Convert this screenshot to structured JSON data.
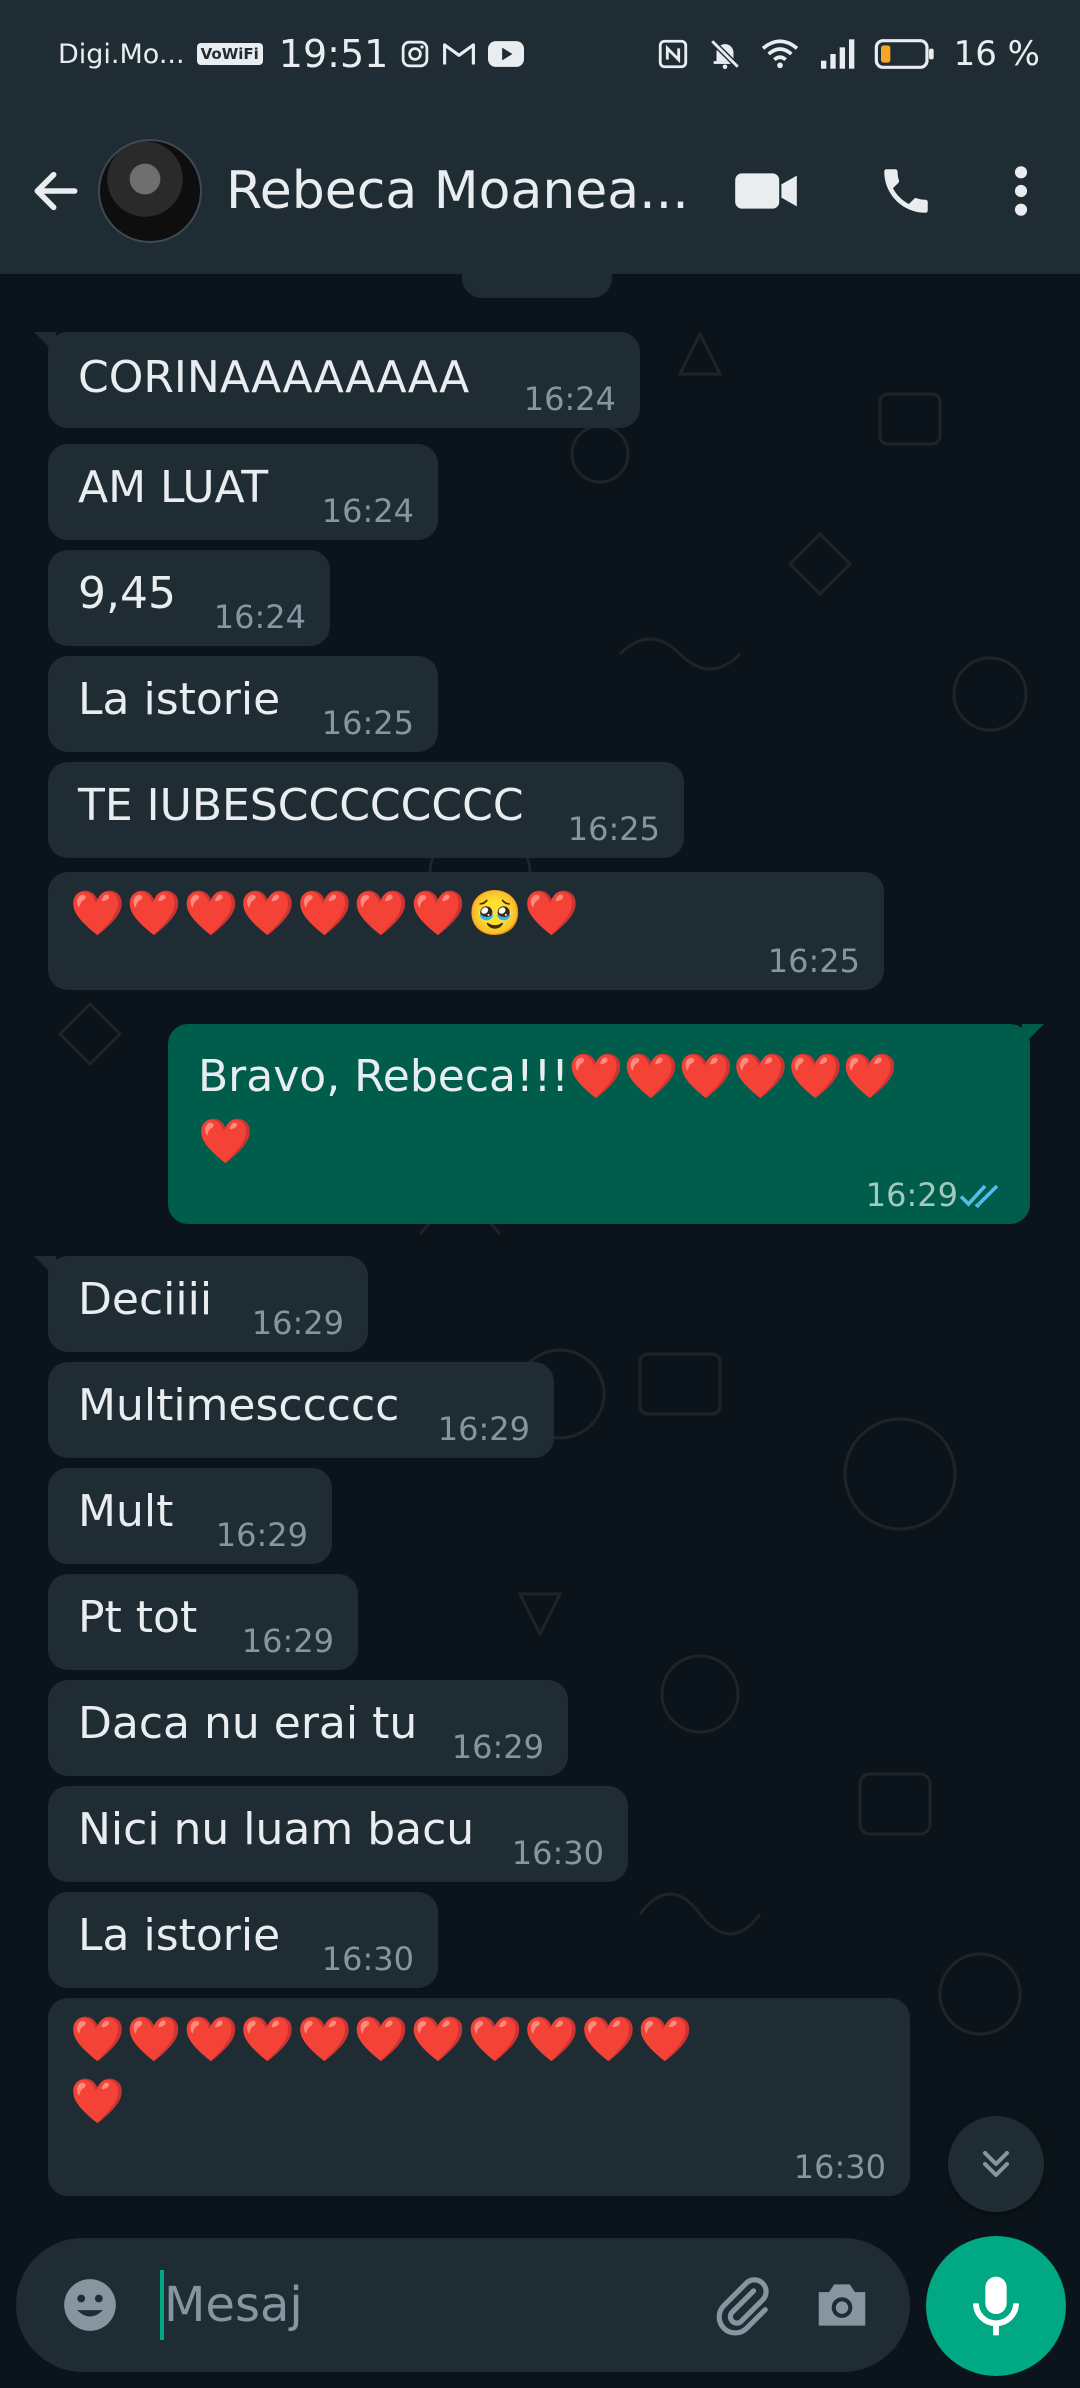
{
  "status_bar": {
    "carrier": "Digi.Mo...",
    "vowifi": "VoWiFi",
    "time": "19:51",
    "battery": "16 %"
  },
  "header": {
    "contact_name": "Rebeca Moanea..."
  },
  "messages": [
    {
      "text": "CORINAAAAAAAA",
      "time": "16:24"
    },
    {
      "text": "AM LUAT",
      "time": "16:24"
    },
    {
      "text": "9,45",
      "time": "16:24"
    },
    {
      "text": "La istorie",
      "time": "16:25"
    },
    {
      "text": "TE IUBESCCCCCCCC",
      "time": "16:25"
    },
    {
      "text": "❤️❤️❤️❤️❤️❤️❤️🥹❤️",
      "time": "16:25"
    },
    {
      "line1": "Bravo, Rebeca!!!❤️❤️❤️❤️❤️❤️",
      "line2": "❤️",
      "time": "16:29"
    },
    {
      "text": "Deciiii",
      "time": "16:29"
    },
    {
      "text": "Multimesccccc",
      "time": "16:29"
    },
    {
      "text": "Mult",
      "time": "16:29"
    },
    {
      "text": "Pt tot",
      "time": "16:29"
    },
    {
      "text": "Daca nu erai tu",
      "time": "16:29"
    },
    {
      "text": "Nici nu luam bacu",
      "time": "16:30"
    },
    {
      "text": "La istorie",
      "time": "16:30"
    },
    {
      "line1": "❤️❤️❤️❤️❤️❤️❤️❤️❤️❤️❤️",
      "line2": "❤️",
      "time": "16:30"
    }
  ],
  "composer": {
    "placeholder": "Mesaj"
  },
  "colors": {
    "background": "#0b141a",
    "header": "#1f2c34",
    "incoming_bubble": "#202c33",
    "outgoing_bubble": "#005c4b",
    "accent": "#00a884",
    "read_ticks": "#53bdeb"
  },
  "icons": [
    "back-arrow-icon",
    "video-call-icon",
    "phone-icon",
    "more-vert-icon",
    "emoji-icon",
    "attach-icon",
    "camera-icon",
    "mic-icon",
    "scroll-down-icon"
  ]
}
